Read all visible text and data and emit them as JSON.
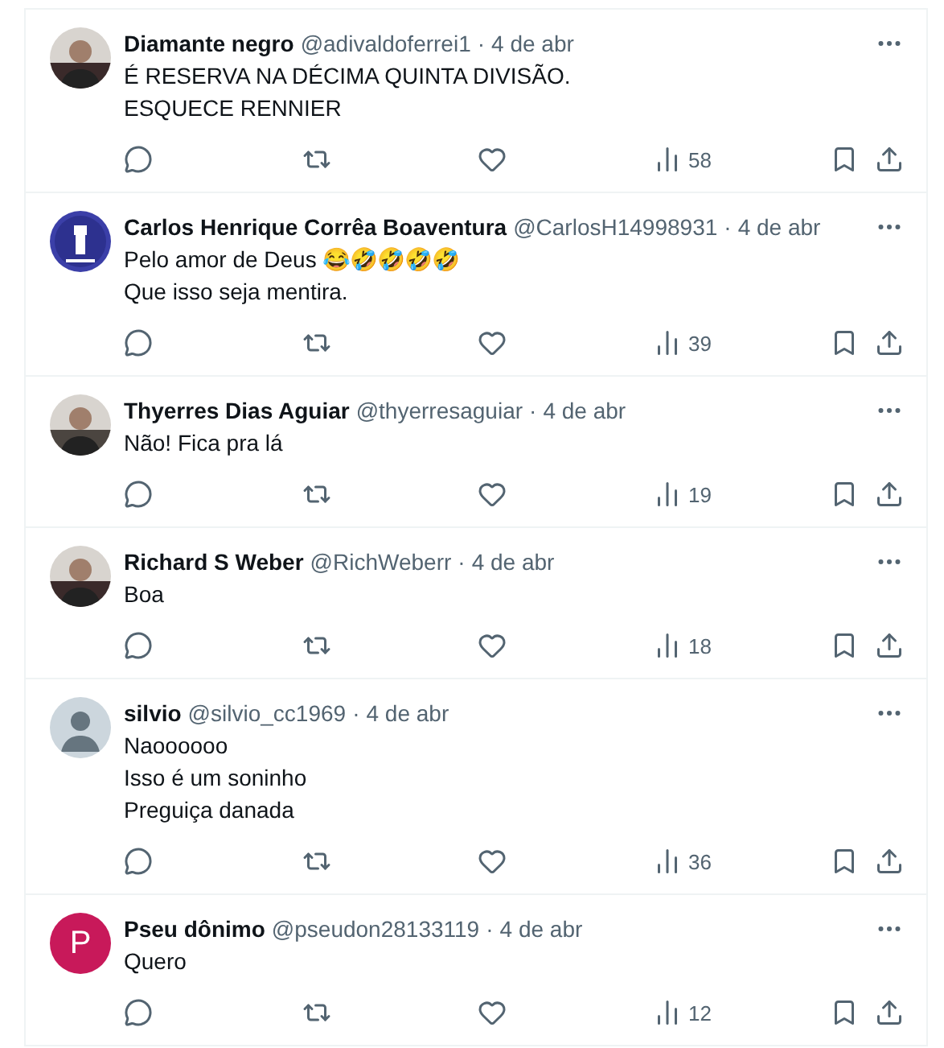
{
  "replies": [
    {
      "name": "Diamante negro",
      "handle": "@adivaldoferrei1",
      "separator": "·",
      "date": "4 de abr",
      "text": "É RESERVA NA DÉCIMA QUINTA DIVISÃO.\nESQUECE RENNIER",
      "views": "58"
    },
    {
      "name": "Carlos Henrique Corrêa Boaventura",
      "handle": "@CarlosH14998931",
      "separator": "·",
      "date": "4 de abr",
      "text": "Pelo amor de Deus 😂🤣🤣🤣🤣\nQue isso seja mentira.",
      "avatar": {
        "kind": "emblem"
      },
      "views": "39"
    },
    {
      "name": "Thyerres Dias Aguiar",
      "handle": "@thyerresaguiar",
      "separator": "·",
      "date": "4 de abr",
      "text": "Não! Fica pra lá",
      "views": "19"
    },
    {
      "name": "Richard S Weber",
      "handle": "@RichWeberr",
      "separator": "·",
      "date": "4 de abr",
      "text": "Boa",
      "views": "18"
    },
    {
      "name": "silvio",
      "handle": "@silvio_cc1969",
      "separator": "·",
      "date": "4 de abr",
      "text": "Naoooooo\nIsso é um soninho\nPreguiça danada",
      "avatar": {
        "kind": "default"
      },
      "views": "36"
    },
    {
      "name": "Pseu dônimo",
      "handle": "@pseudon28133119",
      "separator": "·",
      "date": "4 de abr",
      "text": "Quero",
      "avatar": {
        "kind": "letter",
        "letter": "P",
        "color": "#c8195a"
      },
      "views": "12"
    }
  ]
}
